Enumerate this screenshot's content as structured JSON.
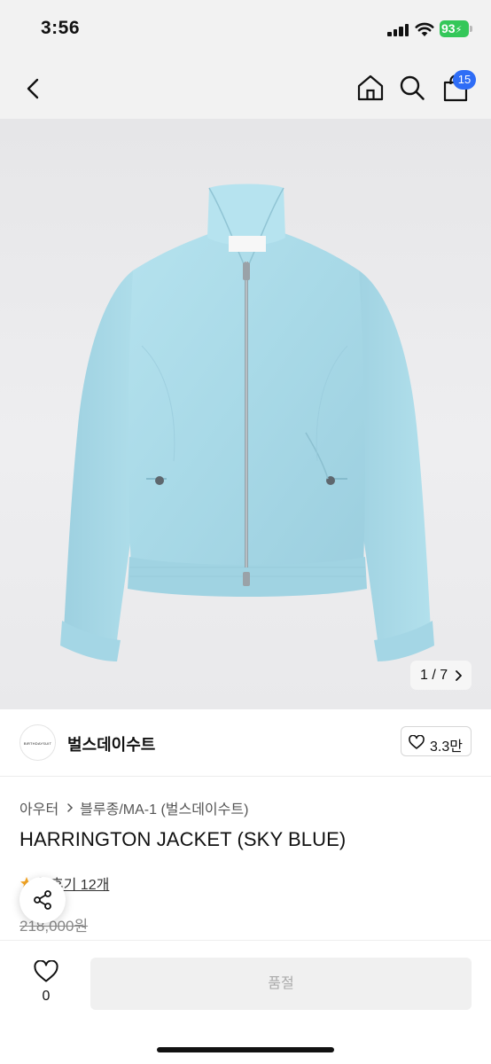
{
  "status_bar": {
    "time": "3:56",
    "battery": "93",
    "battery_color": "#34c759",
    "icons": [
      "signal-icon",
      "wifi-icon",
      "battery-icon"
    ]
  },
  "nav": {
    "icons": [
      "chevron-left-icon",
      "home-icon",
      "search-icon",
      "shopping-bag-icon"
    ],
    "cart_count": "15",
    "badge_color": "#2f6df6"
  },
  "gallery": {
    "counter": "1 / 7",
    "product_color": "#a9dbe9"
  },
  "brand": {
    "logo_text": "BIRTHDAYSUIT",
    "name": "벌스데이수트",
    "likes": "3.3만"
  },
  "product": {
    "breadcrumb": [
      "아우터",
      "블루종/MA-1 (벌스데이수트)"
    ],
    "title": "HARRINGTON JACKET (SKY BLUE)",
    "rating": "3",
    "reviews": "후기 12개",
    "original_price": "218,000원"
  },
  "bottom_bar": {
    "wish_count": "0",
    "soldout_label": "품절"
  }
}
